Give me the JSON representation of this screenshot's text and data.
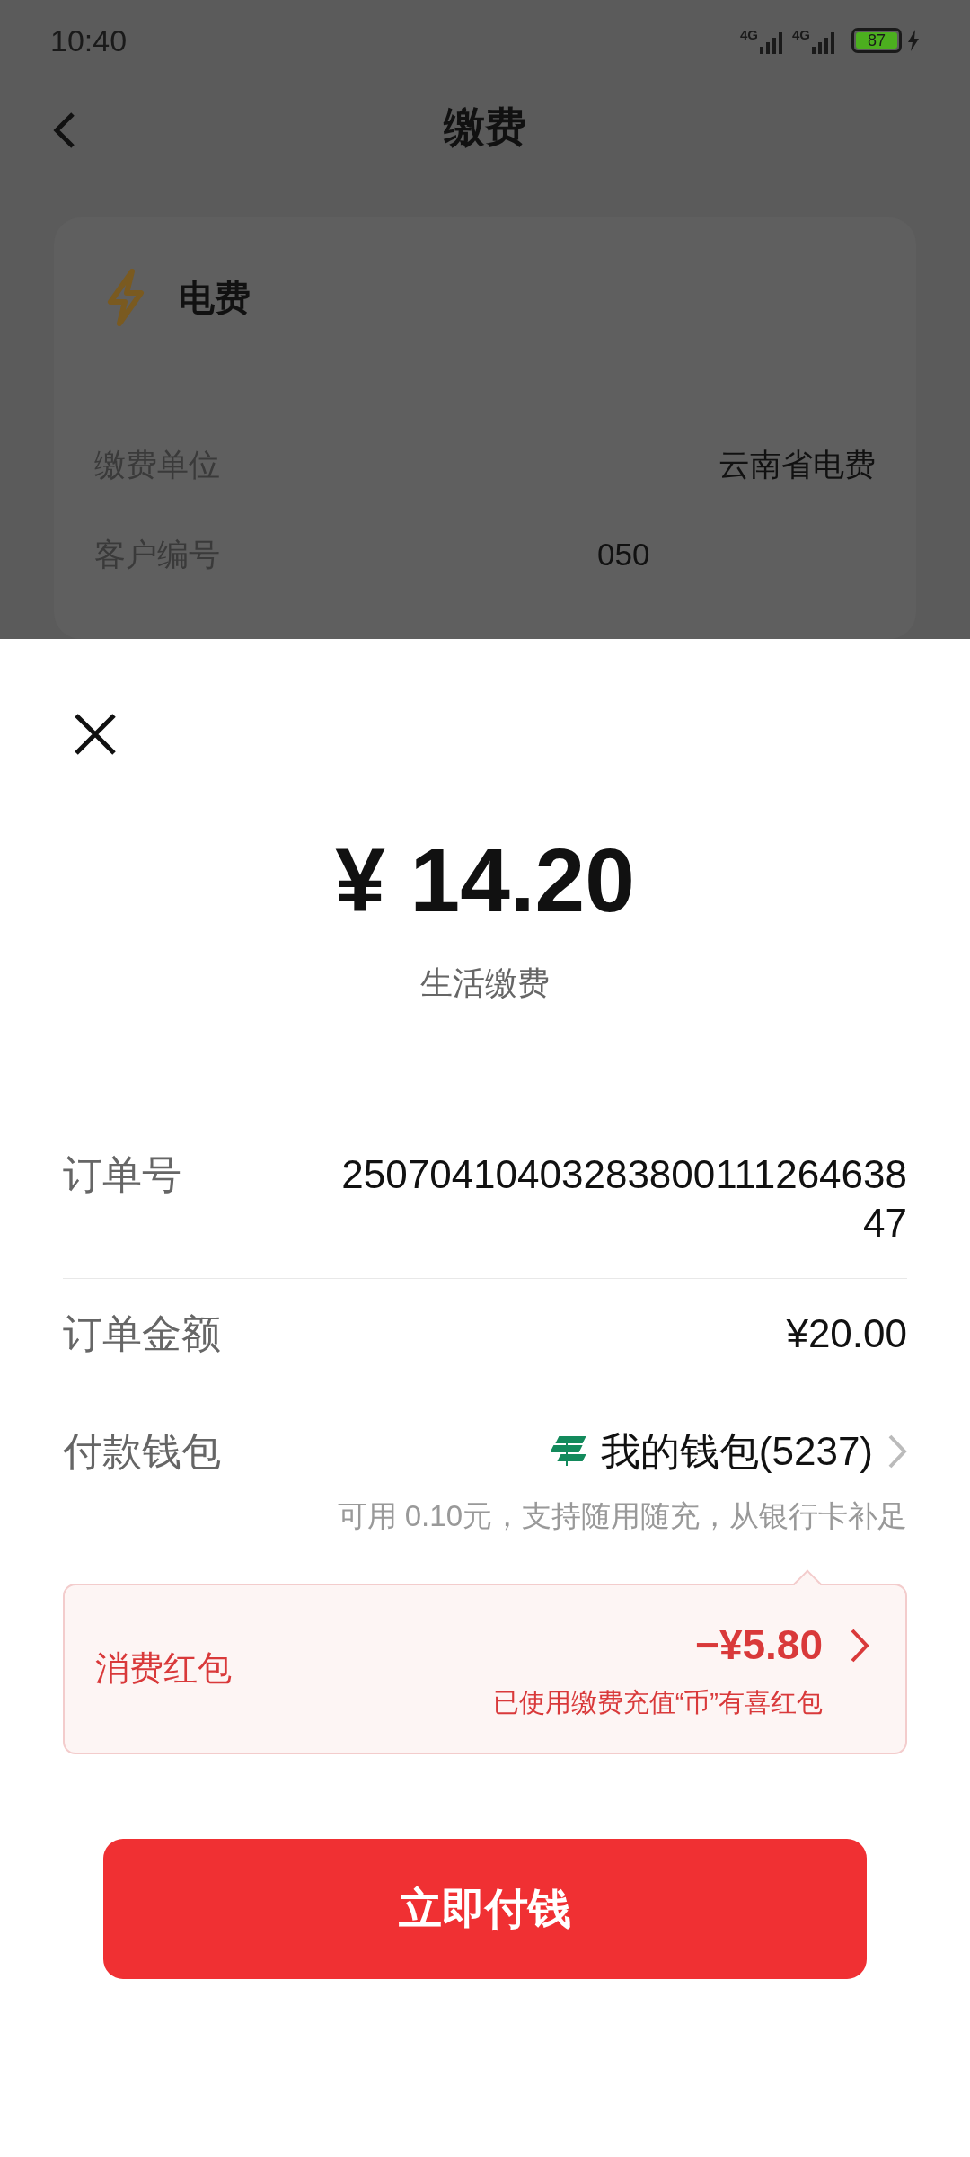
{
  "status_bar": {
    "time": "10:40",
    "network_1": "4G",
    "network_2": "4G",
    "battery": "87"
  },
  "header": {
    "title": "缴费"
  },
  "bill_card": {
    "title": "电费",
    "rows": [
      {
        "label": "缴费单位",
        "value": "云南省电费"
      },
      {
        "label": "客户编号",
        "value": "050"
      }
    ]
  },
  "payment_sheet": {
    "amount": "¥ 14.20",
    "subtitle": "生活缴费",
    "rows": [
      {
        "kind": "text",
        "label": "订单号",
        "value": "2507041040328380011126463847"
      },
      {
        "kind": "text",
        "label": "订单金额",
        "value": "¥20.00"
      },
      {
        "kind": "wallet",
        "label": "付款钱包",
        "value": "我的钱包(5237)",
        "note": "可用 0.10元，支持随用随充，从银行卡补足"
      }
    ],
    "red_packet": {
      "label": "消费红包",
      "amount": "−¥5.80",
      "note": "已使用缴费充值“币”有喜红包"
    },
    "pay_button": "立即付钱"
  }
}
